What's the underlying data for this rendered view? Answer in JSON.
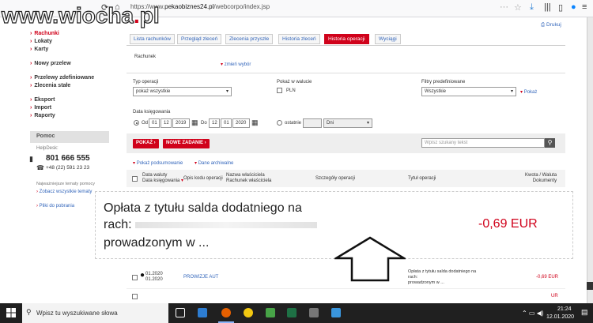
{
  "browser": {
    "url_prefix": "https://www.",
    "url_host": "pekaobiznes24.pl",
    "url_path": "/webcorpo/index.jsp"
  },
  "watermark": {
    "prefix": "www.wiocha",
    "dot": ".",
    "suffix": "pl"
  },
  "sidebar": {
    "items": [
      {
        "label": "Rachunki",
        "active": true
      },
      {
        "label": "Lokaty"
      },
      {
        "label": "Karty"
      },
      {
        "label": "Nowy przelew"
      },
      {
        "label": "Przelewy zdefiniowane"
      },
      {
        "label": "Zlecenia stałe"
      },
      {
        "label": "Eksport"
      },
      {
        "label": "Import"
      },
      {
        "label": "Raporty"
      }
    ],
    "help_title": "Pomoc",
    "helpdesk_label": "HelpDesk:",
    "phone_main": "801 666 555",
    "phone_alt": "+48 (22) 591 23 23",
    "faq_label": "Najważniejsze tematy pomocy",
    "faq_link": "Zobacz wszystkie tematy",
    "downloads_link": "Pliki do pobrania"
  },
  "main": {
    "print_label": "Drukuj",
    "tabs": [
      "Lista rachunków",
      "Przegląd zleceń",
      "Zlecenia przyszłe",
      "Historia zleceń",
      "Historia operacji",
      "Wyciągi"
    ],
    "account_label": "Rachunek",
    "change_link": "zmień wybór",
    "operation_type_label": "Typ operacji",
    "operation_type_value": "pokaż wszystkie",
    "currency_label": "Pokaż w walucie",
    "currency_value": "PLN",
    "filters_label": "Filtry predefiniowane",
    "filters_value": "Wszystkie",
    "show_link": "Pokaż",
    "date_label": "Data księgowania",
    "from_label": "Od",
    "from_day": "01",
    "from_month": "12",
    "from_year": "2019",
    "to_label": "Do",
    "to_day": "12",
    "to_month": "01",
    "to_year": "2020",
    "last_label": "ostatnie",
    "last_unit": "Dni",
    "btn_show": "POKAŻ",
    "btn_new_order": "NOWE ZADANIE",
    "search_placeholder": "Wpisz szukany tekst",
    "summary_link": "Pokaż podsumowanie",
    "archive_link": "Dane archiwalne",
    "columns": {
      "date_currency": "Data waluty",
      "date_booking": "Data księgowania",
      "type_code": "Opis kodu operacji",
      "owner_name": "Nazwa właściciela",
      "owner_account": "Rachunek właściciela",
      "details": "Szczegóły operacji",
      "title": "Tytuł operacji",
      "amount": "Kwota / Waluta",
      "documents": "Dokumenty"
    },
    "row": {
      "date1": "01.2020",
      "date2": "01.2020",
      "code": "PROWIZJE AUT",
      "title_l1": "Opłata z tytułu salda dodatniego na",
      "title_l2": "rach:",
      "title_l3": "prowadzonym w ...",
      "amount": "-0,69 EUR"
    },
    "row2_amount": "UR"
  },
  "overlay": {
    "line1": "Opłata z tytułu salda dodatniego na",
    "line2": "rach:",
    "line3": "prowadzonym w ...",
    "amount": "-0,69 EUR"
  },
  "taskbar": {
    "search_placeholder": "Wpisz tu wyszukiwane słowa",
    "time": "21:24",
    "date": "12.01.2020"
  }
}
